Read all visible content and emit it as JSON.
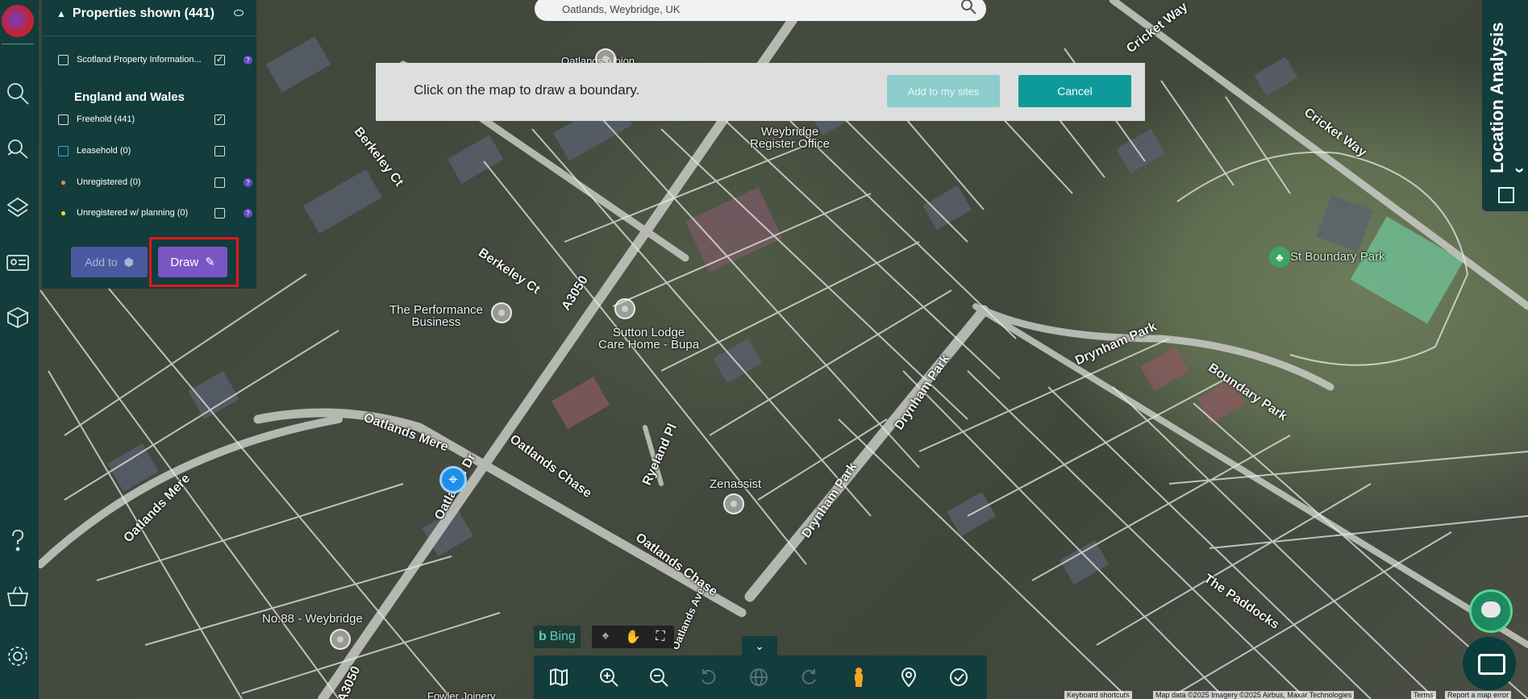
{
  "search": {
    "value": "Oatlands, Weybridge, UK"
  },
  "properties_panel": {
    "title": "Properties shown (441)",
    "scotland": {
      "label": "Scotland Property Information...",
      "help": "?"
    },
    "section_title": "England and Wales",
    "rows": [
      {
        "label": "Freehold (441)",
        "checked": true
      },
      {
        "label": "Leasehold (0)",
        "checked": false
      },
      {
        "label": "Unregistered (0)",
        "checked": false,
        "help": "?"
      },
      {
        "label": "Unregistered w/ planning (0)",
        "checked": false,
        "help": "?"
      }
    ],
    "add_to_label": "Add to",
    "draw_label": "Draw"
  },
  "draw_prompt": {
    "message": "Click on the map to draw a boundary.",
    "add_button": "Add to my sites",
    "cancel_button": "Cancel"
  },
  "right_tab": {
    "title": "Location Analysis"
  },
  "bing": {
    "label": "Bing"
  },
  "map_labels": {
    "berkeley_ct_1": "Berkeley Ct",
    "berkeley_ct_2": "Berkeley Ct",
    "a3050_1": "A3050",
    "a3050_2": "A3050",
    "oatlands_mere": "Oatlands Mere",
    "oatlands_mere_2": "Oatlands Mere",
    "oatlands_dr": "Oatlands Dr",
    "oatlands_chase_1": "Oatlands Chase",
    "oatlands_chase_2": "Oatlands Chase",
    "drynham_park_1": "Drynham Park",
    "drynham_park_2": "Drynham Park",
    "drynham_park_3": "Drynham Park",
    "boundary_park_road": "Boundary Park",
    "cricket_way_1": "Cricket Way",
    "cricket_way_2": "Cricket Way",
    "the_paddocks": "The Paddocks",
    "ryeland_pl": "Ryeland Pl",
    "oatlands_ave": "Oatlands Ave",
    "weybridge_register": "Weybridge\nRegister Office",
    "performance_business": "The Performance\nBusiness",
    "sutton_lodge": "Sutton Lodge\nCare Home - Bupa",
    "zenassist": "Zenassist",
    "no88": "No.88 - Weybridge",
    "fowler": "Fowler Joinery",
    "st_boundary_park": "St Boundary Park",
    "oatlands_albion": "Oatlands Albion"
  },
  "attribution": {
    "shortcuts": "Keyboard shortcuts",
    "data": "Map data ©2025 Imagery ©2025 Airbus, Maxar Technologies",
    "terms": "Terms",
    "report": "Report a map error"
  },
  "colors": {
    "panel_bg": "#133c3c",
    "draw_accent": "#7a56c4",
    "cancel_teal": "#0e9a9a",
    "highlight": "#e2161c"
  }
}
